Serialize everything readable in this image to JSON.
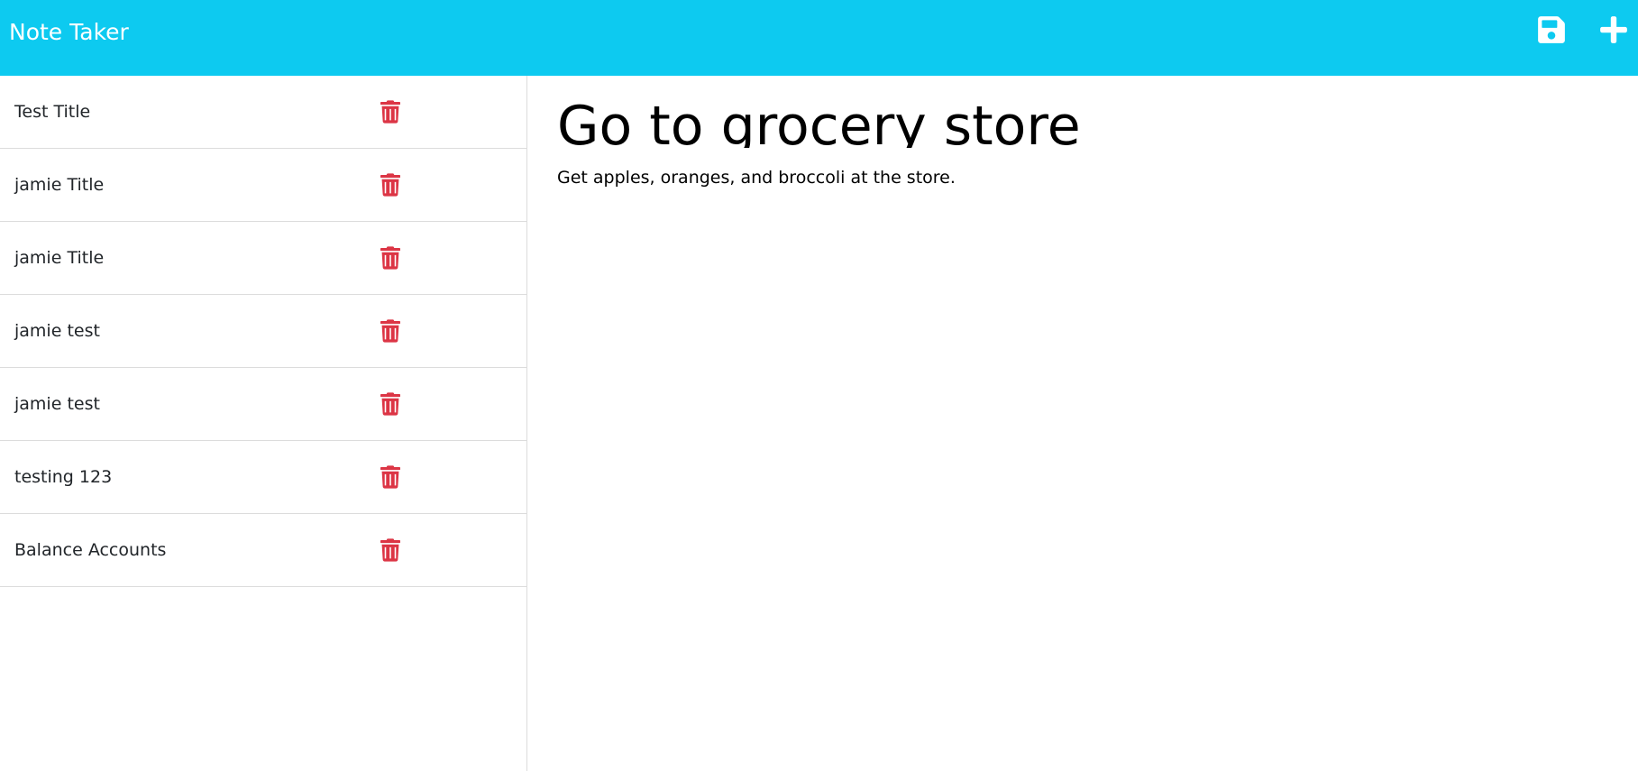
{
  "app": {
    "title": "Note Taker"
  },
  "header": {
    "save_icon": "floppy-disk-icon",
    "new_icon": "plus-icon"
  },
  "sidebar": {
    "notes": [
      {
        "title": "Test Title"
      },
      {
        "title": "jamie Title"
      },
      {
        "title": "jamie Title"
      },
      {
        "title": "jamie test"
      },
      {
        "title": "jamie test"
      },
      {
        "title": "testing 123"
      },
      {
        "title": "Balance Accounts"
      }
    ],
    "delete_icon": "trash-icon"
  },
  "editor": {
    "title": "Go to grocery store",
    "body": "Get apples, oranges, and broccoli at the store."
  },
  "colors": {
    "navbar": "#0dcaf0",
    "delete": "#dc3545",
    "nav_icon": "#ffffff"
  }
}
